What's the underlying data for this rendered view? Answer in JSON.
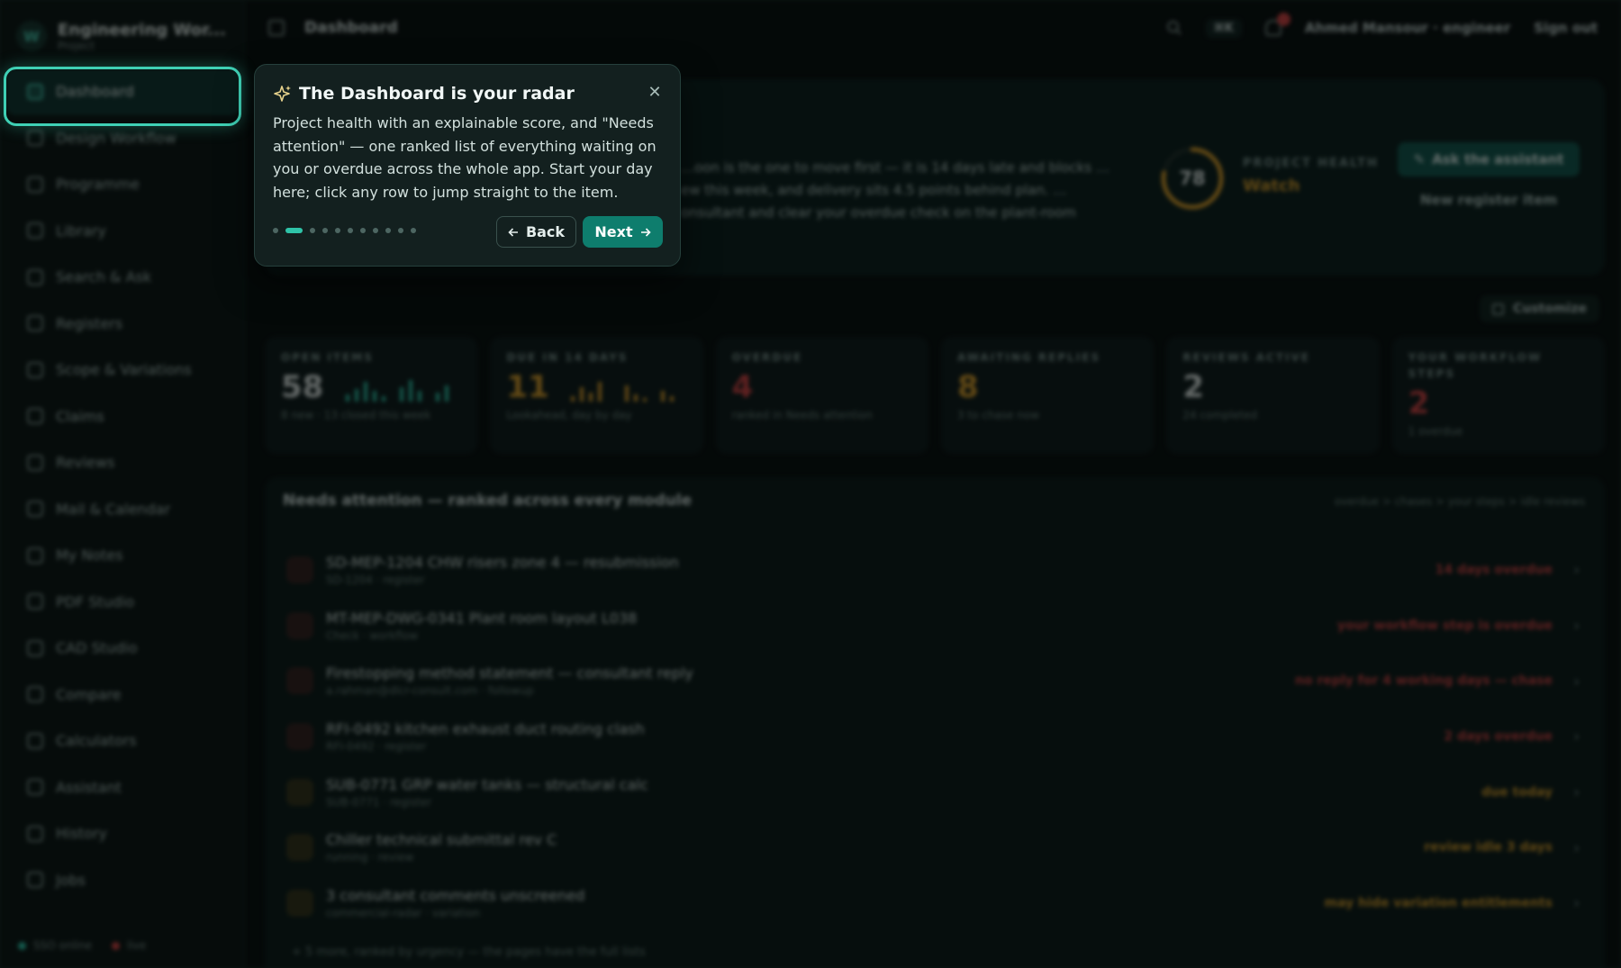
{
  "app": {
    "name": "Engineering Wor...",
    "subtitle": "Project",
    "logo_letter": "W"
  },
  "sidebar": {
    "items": [
      {
        "label": "Dashboard",
        "icon": "dashboard-icon",
        "active": true
      },
      {
        "label": "Design Workflow",
        "icon": "workflow-icon"
      },
      {
        "label": "Programme",
        "icon": "calendar-icon"
      },
      {
        "label": "Library",
        "icon": "folder-icon"
      },
      {
        "label": "Search & Ask",
        "icon": "search-icon"
      },
      {
        "label": "Registers",
        "icon": "list-icon"
      },
      {
        "label": "Scope & Variations",
        "icon": "scope-icon"
      },
      {
        "label": "Claims",
        "icon": "claims-icon"
      },
      {
        "label": "Reviews",
        "icon": "reviews-icon"
      },
      {
        "label": "Mail & Calendar",
        "icon": "mail-icon"
      },
      {
        "label": "My Notes",
        "icon": "notes-icon"
      },
      {
        "label": "PDF Studio",
        "icon": "pdf-icon"
      },
      {
        "label": "CAD Studio",
        "icon": "cad-icon"
      },
      {
        "label": "Compare",
        "icon": "compare-icon"
      },
      {
        "label": "Calculators",
        "icon": "calculator-icon"
      },
      {
        "label": "Assistant",
        "icon": "assistant-icon"
      },
      {
        "label": "History",
        "icon": "history-icon"
      },
      {
        "label": "Jobs",
        "icon": "jobs-icon"
      }
    ],
    "footer": {
      "status_online": "SSO online",
      "status_live": "live"
    }
  },
  "topbar": {
    "breadcrumb": "Dashboard",
    "shortcut": "⌘K",
    "user": "Ahmed Mansour · engineer",
    "signout": "Sign out"
  },
  "hero": {
    "text": "…oon is the one to move first — it is 14 days late and blocks …ew this week, and delivery sits 4.5 points behind plan. …onsultant and clear your overdue check on the plant-room",
    "health_score": "78",
    "health_fraction": 0.78,
    "health_label": "PROJECT HEALTH",
    "health_status": "Watch",
    "ask_label": "Ask the assistant",
    "new_item_label": "New register item",
    "customize_label": "Customize"
  },
  "kpis": [
    {
      "label": "OPEN ITEMS",
      "value": "58",
      "sub": "8 new · 13 closed this week",
      "color": "#d9e5e2"
    },
    {
      "label": "DUE IN 14 DAYS",
      "value": "11",
      "sub": "Lookahead, day by day",
      "color": "#d7a12f"
    },
    {
      "label": "OVERDUE",
      "value": "4",
      "sub": "ranked in Needs attention",
      "color": "#d04747"
    },
    {
      "label": "AWAITING REPLIES",
      "value": "8",
      "sub": "3 to chase now",
      "color": "#d7a12f"
    },
    {
      "label": "REVIEWS ACTIVE",
      "value": "2",
      "sub": "24 completed",
      "color": "#d9e5e2"
    },
    {
      "label": "YOUR WORKFLOW STEPS",
      "value": "2",
      "sub": "1 overdue",
      "color": "#d04747"
    }
  ],
  "attention": {
    "title": "Needs attention — ranked across every module",
    "legend": "overdue > chases > your steps > idle reviews",
    "rows": [
      {
        "title": "SD-MEP-1204 CHW risers zone 4 — resubmission",
        "meta": "SD-1204 · register",
        "reason": "14 days overdue",
        "color": "#d04747"
      },
      {
        "title": "MT-MEP-DWG-0341 Plant room layout L038",
        "meta": "Check · workflow",
        "reason": "your workflow step is overdue",
        "color": "#d04747"
      },
      {
        "title": "Firestopping method statement — consultant reply",
        "meta": "a.rahman@dlcr-consult.com · followup",
        "reason": "no reply for 4 working days — chase",
        "color": "#d04747"
      },
      {
        "title": "RFI-0492 kitchen exhaust duct routing clash",
        "meta": "RFI-0492 · register",
        "reason": "2 days overdue",
        "color": "#d04747"
      },
      {
        "title": "SUB-0771 GRP water tanks — structural calc",
        "meta": "SUB-0771 · register",
        "reason": "due today",
        "color": "#d7a12f"
      },
      {
        "title": "Chiller technical submittal rev C",
        "meta": "running · review",
        "reason": "review idle 3 days",
        "color": "#d7a12f"
      },
      {
        "title": "3 consultant comments unscreened",
        "meta": "commercial-radar · variation",
        "reason": "may hide variation entitlements",
        "color": "#d7a12f"
      }
    ],
    "more": "+ 5 more, ranked by urgency — the pages have the full lists"
  },
  "tour": {
    "title": "The Dashboard is your radar",
    "body": "Project health with an explainable score, and \"Needs attention\" — one ranked list of everything waiting on you or overdue across the whole app. Start your day here; click any row to jump straight to the item.",
    "back_label": "Back",
    "next_label": "Next",
    "step_current": 2,
    "step_total": 11
  },
  "colors": {
    "accent": "#2fc3a8",
    "warning": "#d7a12f",
    "danger": "#d04747"
  }
}
